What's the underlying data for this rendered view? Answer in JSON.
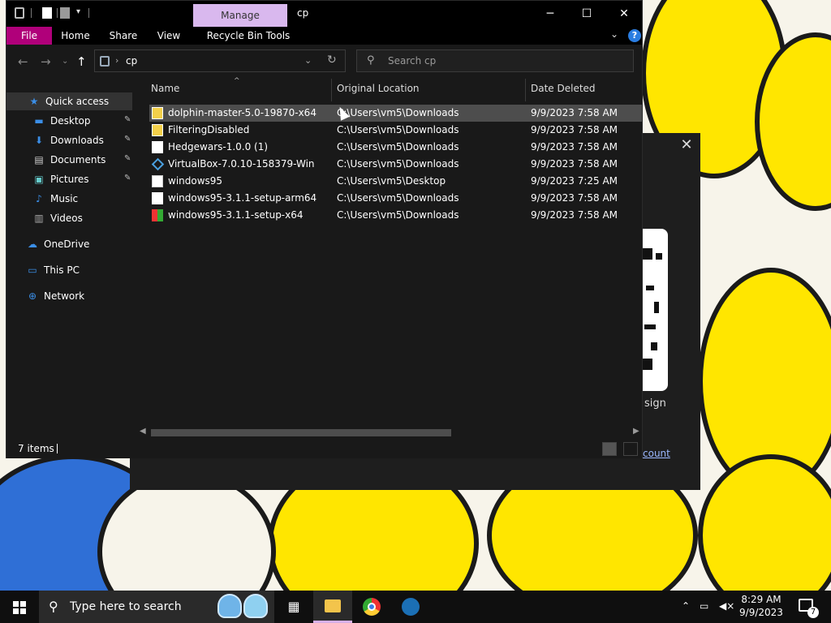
{
  "window": {
    "title": "cp",
    "contextual_tab": "Manage",
    "ribbon_tabs": [
      "File",
      "Home",
      "Share",
      "View",
      "Recycle Bin Tools"
    ],
    "help": "?"
  },
  "address": {
    "crumb": "cp"
  },
  "search": {
    "placeholder": "Search cp"
  },
  "nav": {
    "quick_access": "Quick access",
    "pinned": [
      "Desktop",
      "Downloads",
      "Documents",
      "Pictures"
    ],
    "unpinned": [
      "Music",
      "Videos"
    ],
    "onedrive": "OneDrive",
    "this_pc": "This PC",
    "network": "Network"
  },
  "columns": {
    "name": "Name",
    "location": "Original Location",
    "date": "Date Deleted"
  },
  "files": [
    {
      "name": "dolphin-master-5.0-19870-x64",
      "location": "C:\\Users\\vm5\\Downloads",
      "date": "9/9/2023 7:58 AM",
      "icon": "zip-icon"
    },
    {
      "name": "FilteringDisabled",
      "location": "C:\\Users\\vm5\\Downloads",
      "date": "9/9/2023 7:58 AM",
      "icon": "zip-icon"
    },
    {
      "name": "Hedgewars-1.0.0 (1)",
      "location": "C:\\Users\\vm5\\Downloads",
      "date": "9/9/2023 7:58 AM",
      "icon": "file-icon"
    },
    {
      "name": "VirtualBox-7.0.10-158379-Win",
      "location": "C:\\Users\\vm5\\Downloads",
      "date": "9/9/2023 7:58 AM",
      "icon": "virtualbox-icon"
    },
    {
      "name": "windows95",
      "location": "C:\\Users\\vm5\\Desktop",
      "date": "9/9/2023 7:25 AM",
      "icon": "app-icon"
    },
    {
      "name": "windows95-3.1.1-setup-arm64",
      "location": "C:\\Users\\vm5\\Downloads",
      "date": "9/9/2023 7:58 AM",
      "icon": "file-icon"
    },
    {
      "name": "windows95-3.1.1-setup-x64",
      "location": "C:\\Users\\vm5\\Downloads",
      "date": "9/9/2023 7:58 AM",
      "icon": "installer-icon"
    }
  ],
  "status": {
    "count": "7 items"
  },
  "background_dialog": {
    "sign": "sign",
    "account": "count"
  },
  "taskbar": {
    "search_placeholder": "Type here to search",
    "time": "8:29 AM",
    "date": "9/9/2023",
    "notifications": "7"
  },
  "colors": {
    "file_tab": "#b0007a",
    "manage_tab": "#d9b8ee",
    "accent": "#2a7de1"
  }
}
